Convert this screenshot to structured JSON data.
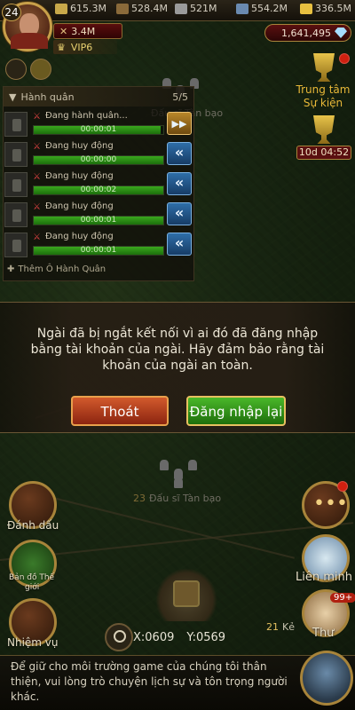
{
  "player": {
    "level": "24",
    "power": "3.4M",
    "vip": "VIP6"
  },
  "resources": [
    {
      "name": "food",
      "value": "615.3M",
      "color": "#c9a94a"
    },
    {
      "name": "wood",
      "value": "528.4M",
      "color": "#8a6a3a"
    },
    {
      "name": "stone",
      "value": "521M",
      "color": "#9a9a9a"
    },
    {
      "name": "iron",
      "value": "554.2M",
      "color": "#6a8ab0"
    },
    {
      "name": "gold",
      "value": "336.5M",
      "color": "#e8c040"
    }
  ],
  "gems": "1,641,495",
  "march": {
    "title": "Hành quân",
    "count": "5/5",
    "rows": [
      {
        "status": "Đang hành quân...",
        "timer": "00:00:01",
        "progress": 0.98,
        "action": "speedup-icon"
      },
      {
        "status": "Đang huy động",
        "timer": "00:00:00",
        "progress": 1.0,
        "action": "recall-icon"
      },
      {
        "status": "Đang huy động",
        "timer": "00:00:02",
        "progress": 1.0,
        "action": "recall-icon"
      },
      {
        "status": "Đang huy động",
        "timer": "00:00:01",
        "progress": 1.0,
        "action": "recall-icon"
      },
      {
        "status": "Đang huy động",
        "timer": "00:00:01",
        "progress": 1.0,
        "action": "recall-icon"
      }
    ],
    "add_label": "Thêm Ô Hành Quân"
  },
  "map_markers": {
    "top_label": "Đấu sĩ Tàn bạo",
    "mid_num": "23",
    "mid_label": "Đấu sĩ Tàn bạo",
    "ke_num": "21",
    "ke_label": "Kẻ"
  },
  "event": {
    "label_line1": "Trung tâm",
    "label_line2": "Sự kiện",
    "timer": "10d 04:52"
  },
  "dialog": {
    "message": "Ngài đã bị ngắt kết nối vì ai đó đã đăng nhập bằng tài khoản của ngài. Hãy đảm bảo rằng tài khoản của ngài an toàn.",
    "exit_label": "Thoát",
    "relogin_label": "Đăng nhập lại"
  },
  "left_menu": {
    "bookmark": "Đánh dấu",
    "world_map_line1": "Bản đồ Thế",
    "world_map_line2": "giới",
    "quests": "Nhiệm vụ"
  },
  "right_menu": {
    "alliance": "Liên minh",
    "mail": "Thư",
    "mail_badge": "99+"
  },
  "coords": {
    "x_label": "X:0609",
    "y_label": "Y:0569"
  },
  "chat": {
    "text": "Để giữ cho môi trường game của chúng tôi thân thiện, vui lòng trò chuyện lịch sự và tôn trọng người khác."
  }
}
